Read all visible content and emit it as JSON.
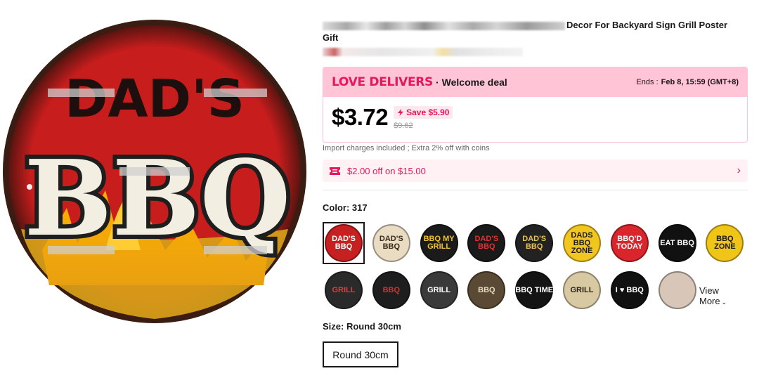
{
  "product": {
    "title_visible": "Decor For Backyard Sign Grill Poster Gift",
    "image_text_top": "DAD'S",
    "image_text_main": "BBQ"
  },
  "deal": {
    "brand": "LOVE DELIVERS",
    "separator": "·",
    "welcome": "Welcome deal",
    "ends_label": "Ends :",
    "ends_time": "Feb 8, 15:59 (GMT+8)",
    "brand_color": "#e8175d",
    "header_bg": "#ffc4d6"
  },
  "price": {
    "current": "$3.72",
    "save": "Save $5.90",
    "original": "$9.62"
  },
  "import_note": "Import charges included ; Extra 2% off with coins",
  "coupon": {
    "text": "$2.00 off on $15.00",
    "icon": "coupon-ticket-icon",
    "chevron": "›"
  },
  "color": {
    "label": "Color: 317",
    "swatches": [
      {
        "text": "DAD'S BBQ",
        "bg": "#c62020",
        "fg": "#ffffff",
        "selected": true
      },
      {
        "text": "DAD'S BBQ",
        "bg": "#e9dcc3",
        "fg": "#3a2a1a",
        "selected": false
      },
      {
        "text": "BBQ MY GRILL",
        "bg": "#1b1b1b",
        "fg": "#f2c230",
        "selected": false
      },
      {
        "text": "DAD'S BBQ",
        "bg": "#1a1a1a",
        "fg": "#e03030",
        "selected": false
      },
      {
        "text": "DAD'S BBQ",
        "bg": "#222222",
        "fg": "#e8c15a",
        "selected": false
      },
      {
        "text": "DADS BBQ ZONE",
        "bg": "#f2c61f",
        "fg": "#1a1a1a",
        "selected": false
      },
      {
        "text": "BBQ'D TODAY",
        "bg": "#d9252b",
        "fg": "#ffffff",
        "selected": false
      },
      {
        "text": "EAT BBQ",
        "bg": "#111111",
        "fg": "#ffffff",
        "selected": false
      },
      {
        "text": "BBQ ZONE",
        "bg": "#f0c419",
        "fg": "#1a1a1a",
        "selected": false
      },
      {
        "text": "GRILL",
        "bg": "#2a2a2a",
        "fg": "#e23b3b",
        "selected": false
      },
      {
        "text": "BBQ",
        "bg": "#1e1e1e",
        "fg": "#d83030",
        "selected": false
      },
      {
        "text": "GRILL",
        "bg": "#3a3a3a",
        "fg": "#ffffff",
        "selected": false
      },
      {
        "text": "BBQ",
        "bg": "#5a4a35",
        "fg": "#e8dcc0",
        "selected": false
      },
      {
        "text": "BBQ TIME",
        "bg": "#141414",
        "fg": "#ffffff",
        "selected": false
      },
      {
        "text": "GRILL",
        "bg": "#d8c9a3",
        "fg": "#2a2015",
        "selected": false
      },
      {
        "text": "I ♥ BBQ",
        "bg": "#111111",
        "fg": "#ffffff",
        "selected": false
      },
      {
        "text": "",
        "bg": "#d8c7b8",
        "fg": "#8a6a55",
        "selected": false
      }
    ],
    "view_more": "View More",
    "view_more_chevron": "⌄"
  },
  "size": {
    "label": "Size: Round 30cm",
    "option": "Round 30cm"
  }
}
